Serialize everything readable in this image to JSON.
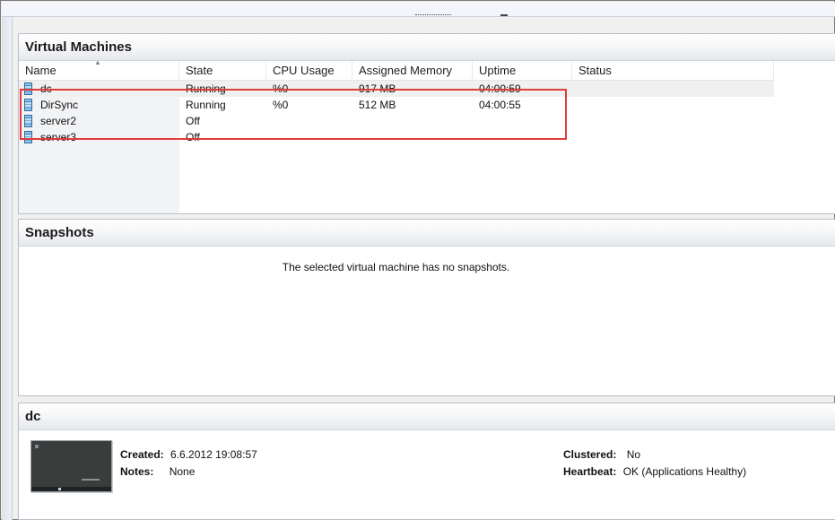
{
  "vm_pane": {
    "title": "Virtual Machines",
    "columns": [
      "Name",
      "State",
      "CPU Usage",
      "Assigned Memory",
      "Uptime",
      "Status"
    ],
    "rows": [
      {
        "name": "dc",
        "state": "Running",
        "cpu": "%0",
        "memory": "917 MB",
        "uptime": "04:00:59",
        "status": ""
      },
      {
        "name": "DirSync",
        "state": "Running",
        "cpu": "%0",
        "memory": "512 MB",
        "uptime": "04:00:55",
        "status": ""
      },
      {
        "name": "server2",
        "state": "Off",
        "cpu": "",
        "memory": "",
        "uptime": "",
        "status": ""
      },
      {
        "name": "server3",
        "state": "Off",
        "cpu": "",
        "memory": "",
        "uptime": "",
        "status": ""
      }
    ],
    "highlight_color": "#e23b3b"
  },
  "snapshots_pane": {
    "title": "Snapshots",
    "empty_message": "The selected virtual machine has no snapshots."
  },
  "details_pane": {
    "title": "dc",
    "created_label": "Created:",
    "created_value": "6.6.2012 19:08:57",
    "notes_label": "Notes:",
    "notes_value": "None",
    "clustered_label": "Clustered:",
    "clustered_value": "No",
    "heartbeat_label": "Heartbeat:",
    "heartbeat_value": "OK (Applications Healthy)"
  },
  "icons": {
    "vm": "virtual-machine-icon",
    "sort": "sort-ascending-icon"
  }
}
